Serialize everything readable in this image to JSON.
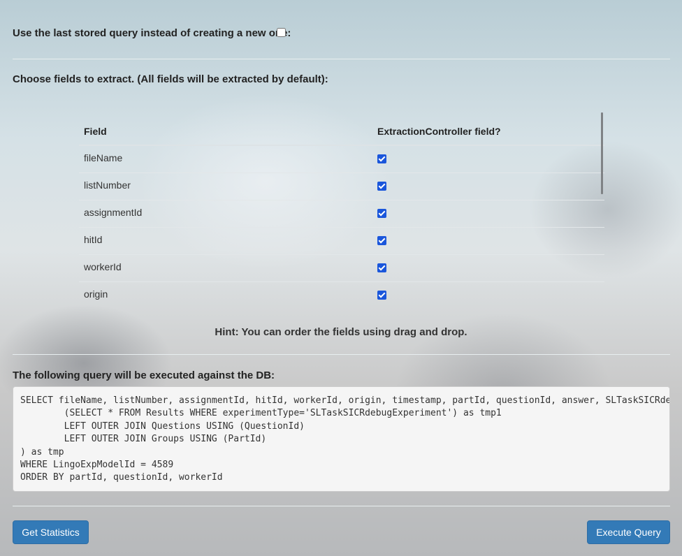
{
  "stored_query": {
    "label": "Use the last stored query instead of creating a new one:",
    "checked": false
  },
  "fields_section": {
    "title": "Choose fields to extract. (All fields will be extracted by default):",
    "columns": [
      "Field",
      "ExtractionController field?"
    ],
    "rows": [
      {
        "field": "fileName",
        "checked": true
      },
      {
        "field": "listNumber",
        "checked": true
      },
      {
        "field": "assignmentId",
        "checked": true
      },
      {
        "field": "hitId",
        "checked": true
      },
      {
        "field": "workerId",
        "checked": true
      },
      {
        "field": "origin",
        "checked": true
      }
    ],
    "hint": "Hint: You can order the fields using drag and drop."
  },
  "query_section": {
    "title": "The following query will be executed against the DB:",
    "query": "SELECT fileName, listNumber, assignmentId, hitId, workerId, origin, timestamp, partId, questionId, answer, SLTaskSICRde\n        (SELECT * FROM Results WHERE experimentType='SLTaskSICRdebugExperiment') as tmp1\n        LEFT OUTER JOIN Questions USING (QuestionId)\n        LEFT OUTER JOIN Groups USING (PartId)\n) as tmp\nWHERE LingoExpModelId = 4589\nORDER BY partId, questionId, workerId"
  },
  "buttons": {
    "get_statistics": "Get Statistics",
    "execute_query": "Execute Query"
  },
  "colors": {
    "button": "#337ab7",
    "checkbox": "#1a56db"
  }
}
